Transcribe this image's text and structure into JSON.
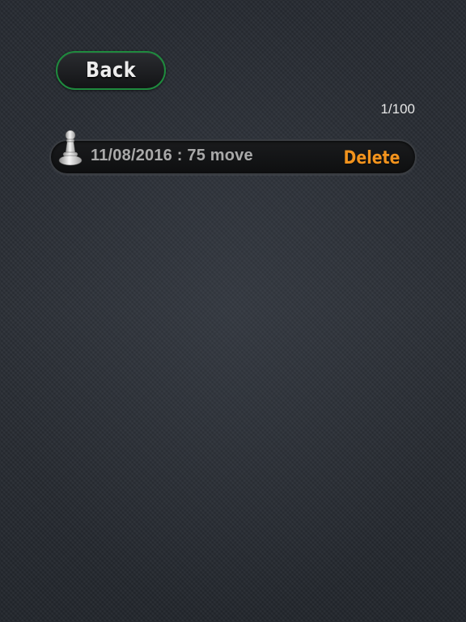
{
  "header": {
    "back_label": "Back",
    "page_counter": "1/100"
  },
  "saved_games": [
    {
      "icon": "pawn-icon",
      "label": "11/08/2016 : 75 move",
      "delete_label": "Delete"
    }
  ],
  "colors": {
    "back_border": "#1f8a3e",
    "delete_text": "#f2931d",
    "row_text": "#a9a9a9",
    "background": "#282c33"
  }
}
